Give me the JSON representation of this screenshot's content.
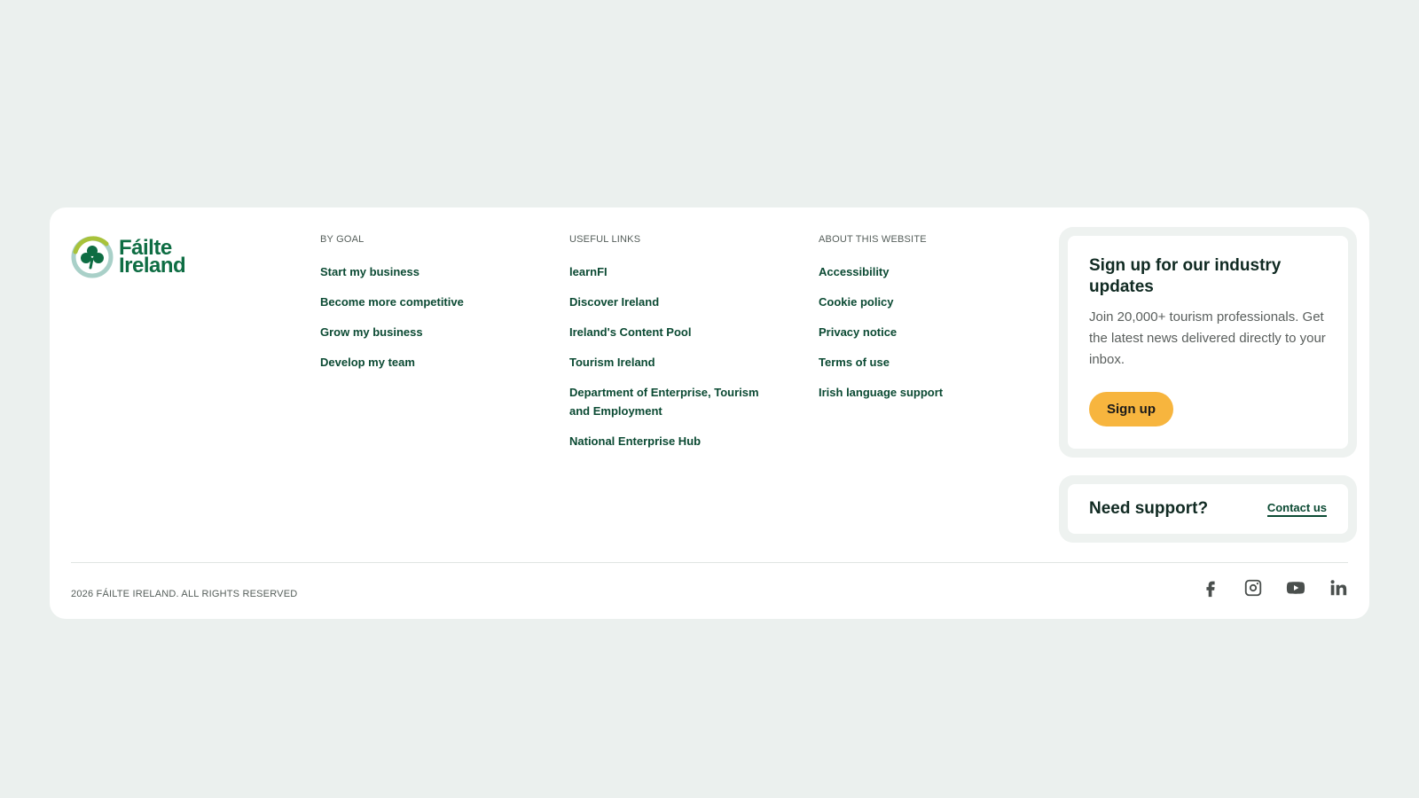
{
  "brand": {
    "line1": "Fáilte",
    "line2": "Ireland",
    "icon": "shamrock-logo-icon",
    "colors": {
      "primary": "#0e6d43",
      "accent": "#f7b53e",
      "ring_light": "#a9d0c8",
      "ring_lime": "#a8c23a"
    }
  },
  "columns": {
    "goal": {
      "heading": "BY GOAL",
      "links": [
        "Start my business",
        "Become more competitive",
        "Grow my business",
        "Develop my team"
      ]
    },
    "useful": {
      "heading": "USEFUL LINKS",
      "links": [
        "learnFI",
        "Discover Ireland",
        "Ireland's Content Pool",
        "Tourism Ireland",
        "Department of Enterprise, Tourism and Employment",
        "National Enterprise Hub"
      ]
    },
    "about": {
      "heading": "ABOUT THIS WEBSITE",
      "links": [
        "Accessibility",
        "Cookie policy",
        "Privacy notice",
        "Terms of use",
        "Irish language support"
      ]
    }
  },
  "signup": {
    "title": "Sign up for our industry updates",
    "description": "Join 20,000+ tourism professionals. Get the latest news delivered directly to your inbox.",
    "button_label": "Sign up"
  },
  "support": {
    "title": "Need support?",
    "link_label": "Contact us"
  },
  "footer_bottom": {
    "copyright": "2026 FÁILTE IRELAND. ALL RIGHTS RESERVED",
    "social_icons": [
      "facebook-icon",
      "instagram-icon",
      "youtube-icon",
      "linkedin-icon"
    ]
  }
}
